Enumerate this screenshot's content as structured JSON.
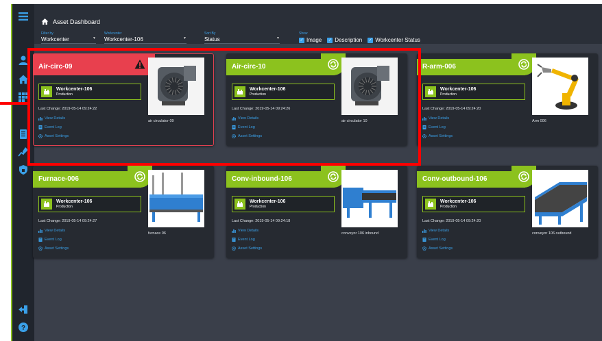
{
  "header": {
    "title": "Asset Dashboard"
  },
  "filters": {
    "filter_by": {
      "label": "Filter by",
      "value": "Workcenter"
    },
    "workcenter": {
      "label": "Workcenter",
      "value": "Workcenter-106"
    },
    "sort_by": {
      "label": "Sort By",
      "value": "Status"
    },
    "show": {
      "label": "Show",
      "options": [
        {
          "label": "Image",
          "checked": true
        },
        {
          "label": "Description",
          "checked": true
        },
        {
          "label": "Workcenter Status",
          "checked": true
        }
      ]
    }
  },
  "links": {
    "view_details": "View Details",
    "event_log": "Event Log",
    "asset_settings": "Asset Settings"
  },
  "cards": [
    {
      "name": "Air-circ-09",
      "status": "alarm",
      "workcenter": "Workcenter-106",
      "wc_status": "Production",
      "last_change": "Last Change: 2019-05-14 09:24:22",
      "image_caption": "air circulator 09",
      "image": "fan"
    },
    {
      "name": "Air-circ-10",
      "status": "ok",
      "workcenter": "Workcenter-106",
      "wc_status": "Production",
      "last_change": "Last Change: 2019-05-14 09:24:26",
      "image_caption": "air circulator 10",
      "image": "fan"
    },
    {
      "name": "R-arm-006",
      "status": "ok",
      "workcenter": "Workcenter-106",
      "wc_status": "Production",
      "last_change": "Last Change: 2019-05-14 09:24:20",
      "image_caption": "Arm 006",
      "image": "arm"
    },
    {
      "name": "Furnace-006",
      "status": "ok",
      "workcenter": "Workcenter-106",
      "wc_status": "Production",
      "last_change": "Last Change: 2019-05-14 09:24:27",
      "image_caption": "furnace 06",
      "image": "furnace"
    },
    {
      "name": "Conv-inbound-106",
      "status": "ok",
      "workcenter": "Workcenter-106",
      "wc_status": "Production",
      "last_change": "Last Change: 2019-05-14 09:24:18",
      "image_caption": "conveyor 106 inbound",
      "image": "conveyor"
    },
    {
      "name": "Conv-outbound-106",
      "status": "ok",
      "workcenter": "Workcenter-106",
      "wc_status": "Production",
      "last_change": "Last Change: 2019-05-14 09:24:20",
      "image_caption": "conveyor 106 outbound",
      "image": "conveyor2"
    }
  ],
  "sidebar": {
    "icons": [
      "menu-icon",
      "user-icon",
      "home-icon",
      "grid-icon",
      "document-icon",
      "chart-edit-icon",
      "lock-icon",
      "logout-icon",
      "help-icon"
    ]
  },
  "colors": {
    "accent_green": "#8cc21e",
    "alarm_red": "#e8404e",
    "link_blue": "#3aa0e8",
    "highlight_red": "#ff0000"
  }
}
